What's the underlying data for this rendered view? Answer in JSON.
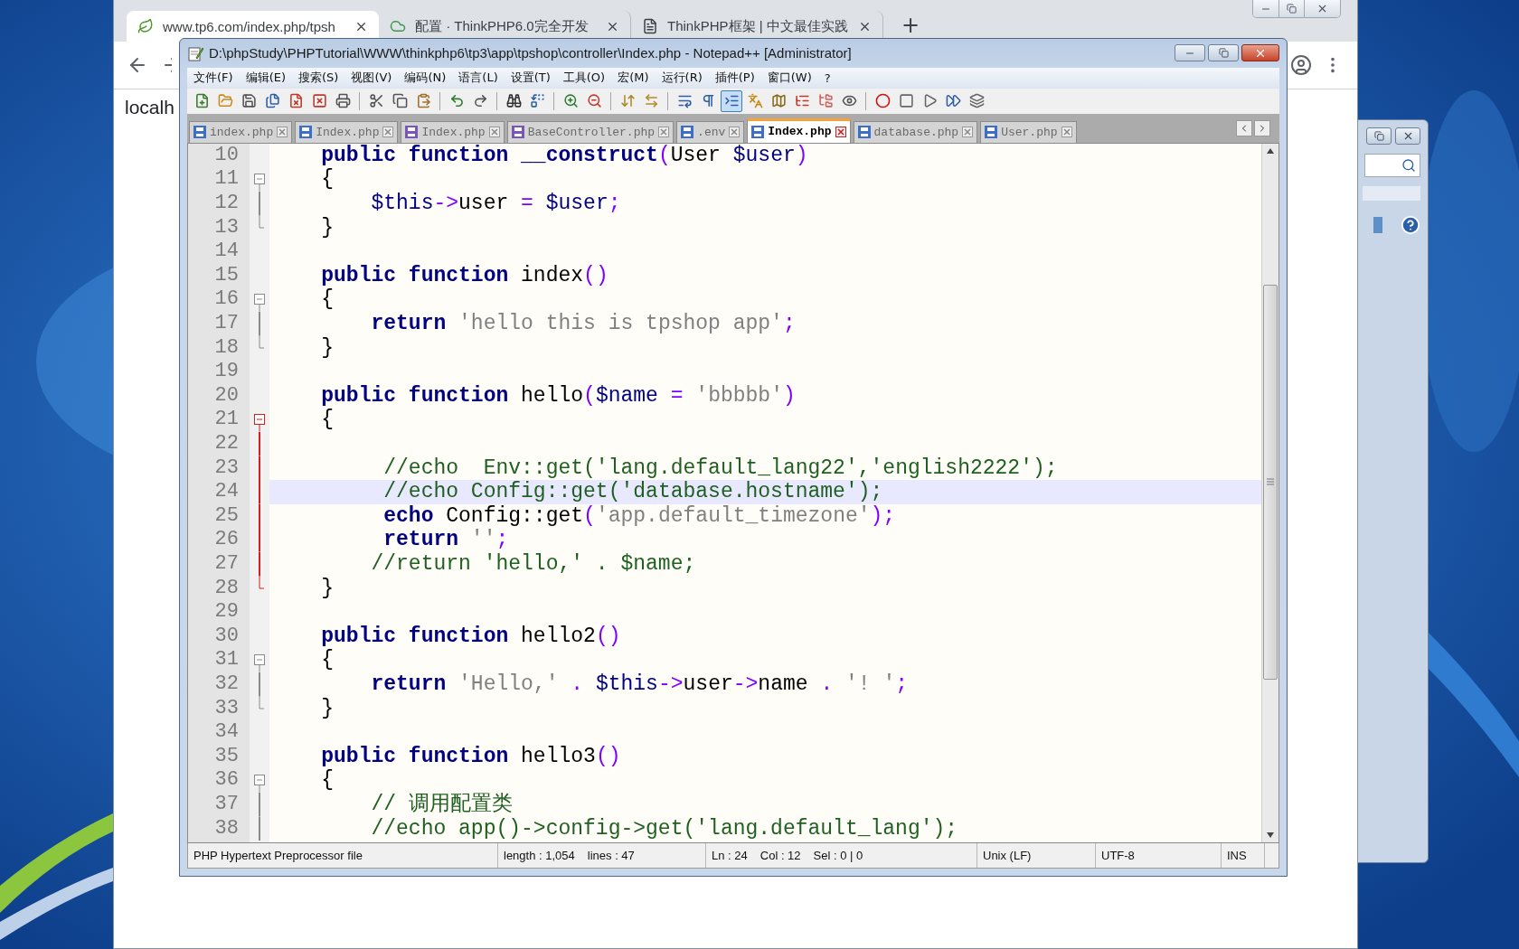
{
  "browser": {
    "tabs": [
      {
        "title": "www.tp6.com/index.php/tpsh",
        "selected": true
      },
      {
        "title": "配置 · ThinkPHP6.0完全开发",
        "selected": false
      },
      {
        "title": "ThinkPHP框架 | 中文最佳实践",
        "selected": false
      }
    ],
    "new_tab": "+",
    "page_text": "localh"
  },
  "editor_window": {
    "title": "D:\\phpStudy\\PHPTutorial\\WWW\\thinkphp6\\tp3\\app\\tpshop\\controller\\Index.php - Notepad++ [Administrator]",
    "menu": [
      "文件(F)",
      "编辑(E)",
      "搜索(S)",
      "视图(V)",
      "编码(N)",
      "语言(L)",
      "设置(T)",
      "工具(O)",
      "宏(M)",
      "运行(R)",
      "插件(P)",
      "窗口(W)",
      "?"
    ],
    "toolbar": [
      {
        "on": false
      },
      {
        "on": false
      },
      {
        "on": false
      },
      {
        "on": false
      },
      {
        "on": false
      },
      {
        "on": false
      },
      {
        "on": false
      },
      {
        "on": false
      },
      {
        "on": false
      },
      {
        "on": false
      },
      {
        "on": false
      },
      {
        "on": false
      },
      {
        "on": false
      },
      {
        "on": false
      },
      {
        "on": false
      },
      {
        "on": false
      },
      {
        "on": false
      },
      {
        "on": false
      },
      {
        "on": false
      },
      {
        "on": false
      },
      {
        "on": true
      },
      {
        "on": false
      },
      {
        "on": false
      },
      {
        "on": false
      },
      {
        "on": false
      },
      {
        "on": false
      },
      {
        "on": false
      },
      {
        "on": false
      },
      {
        "on": false
      },
      {
        "on": false
      },
      {
        "on": false
      }
    ],
    "tabs": [
      {
        "label": "index.php",
        "selected": false,
        "color": "#3b6fc9"
      },
      {
        "label": "Index.php",
        "selected": false,
        "color": "#3b6fc9"
      },
      {
        "label": "Index.php",
        "selected": false,
        "color": "#7b55b8"
      },
      {
        "label": "BaseController.php",
        "selected": false,
        "color": "#7b55b8"
      },
      {
        "label": ".env",
        "selected": false,
        "color": "#3b6fc9"
      },
      {
        "label": "Index.php",
        "selected": true,
        "color": "#3b6fc9"
      },
      {
        "label": "database.php",
        "selected": false,
        "color": "#3b6fc9"
      },
      {
        "label": "User.php",
        "selected": false,
        "color": "#3b6fc9"
      }
    ],
    "lines": [
      {
        "number": "10",
        "kind": "declaration",
        "current": false,
        "tokens": [
          {
            "kind": "keyword",
            "text": "public function __construct"
          },
          {
            "kind": "operator",
            "text": "("
          },
          {
            "kind": "plain",
            "text": "User "
          },
          {
            "kind": "variable",
            "text": "$user"
          },
          {
            "kind": "operator",
            "text": ")"
          }
        ]
      },
      {
        "number": "11",
        "kind": "declaration",
        "current": false,
        "fold": {
          "kind": "open",
          "active": false
        },
        "tokens": [
          {
            "kind": "plain",
            "text": "{"
          }
        ]
      },
      {
        "number": "12",
        "kind": "statement",
        "current": false,
        "fold": {
          "kind": "line",
          "active": false
        },
        "tokens": [
          {
            "kind": "variable",
            "text": "$this"
          },
          {
            "kind": "operator",
            "text": "->"
          },
          {
            "kind": "plain",
            "text": "user "
          },
          {
            "kind": "operator",
            "text": "="
          },
          {
            "kind": "variable",
            "text": " $user"
          },
          {
            "kind": "operator",
            "text": ";"
          }
        ]
      },
      {
        "number": "13",
        "kind": "declaration",
        "current": false,
        "fold": {
          "kind": "close",
          "active": false
        },
        "tokens": [
          {
            "kind": "plain",
            "text": "}"
          }
        ]
      },
      {
        "number": "14",
        "current": false
      },
      {
        "number": "15",
        "kind": "declaration",
        "current": false,
        "tokens": [
          {
            "kind": "keyword",
            "text": "public function"
          },
          {
            "kind": "plain",
            "text": " index"
          },
          {
            "kind": "operator",
            "text": "()"
          }
        ]
      },
      {
        "number": "16",
        "kind": "declaration",
        "current": false,
        "fold": {
          "kind": "open",
          "active": false
        },
        "tokens": [
          {
            "kind": "plain",
            "text": "{"
          }
        ]
      },
      {
        "number": "17",
        "kind": "statement",
        "current": false,
        "fold": {
          "kind": "line",
          "active": false
        },
        "tokens": [
          {
            "kind": "keyword",
            "text": "return"
          },
          {
            "kind": "string",
            "text": " 'hello this is tpshop app'"
          },
          {
            "kind": "operator",
            "text": ";"
          }
        ]
      },
      {
        "number": "18",
        "kind": "declaration",
        "current": false,
        "fold": {
          "kind": "close",
          "active": false
        },
        "tokens": [
          {
            "kind": "plain",
            "text": "}"
          }
        ]
      },
      {
        "number": "19",
        "current": false
      },
      {
        "number": "20",
        "kind": "declaration",
        "current": false,
        "tokens": [
          {
            "kind": "keyword",
            "text": "public function"
          },
          {
            "kind": "plain",
            "text": " hello"
          },
          {
            "kind": "operator",
            "text": "("
          },
          {
            "kind": "variable",
            "text": "$name"
          },
          {
            "kind": "operator",
            "text": " ="
          },
          {
            "kind": "string",
            "text": " 'bbbbb'"
          },
          {
            "kind": "operator",
            "text": ")"
          }
        ]
      },
      {
        "number": "21",
        "kind": "declaration",
        "current": false,
        "fold": {
          "kind": "open",
          "active": true
        },
        "tokens": [
          {
            "kind": "plain",
            "text": "{"
          }
        ]
      },
      {
        "number": "22",
        "current": false,
        "fold": {
          "kind": "line",
          "active": true
        }
      },
      {
        "number": "23",
        "kind": "nested",
        "current": false,
        "fold": {
          "kind": "line",
          "active": true
        },
        "tokens": [
          {
            "kind": "comment",
            "text": "//echo  Env::get('lang.default_lang22','english2222');"
          }
        ]
      },
      {
        "number": "24",
        "kind": "nested",
        "current": true,
        "fold": {
          "kind": "line",
          "active": true
        },
        "tokens": [
          {
            "kind": "comment",
            "text": "//echo Config::get('database.hostname');"
          }
        ]
      },
      {
        "number": "25",
        "kind": "nested",
        "current": false,
        "fold": {
          "kind": "line",
          "active": true
        },
        "tokens": [
          {
            "kind": "keyword",
            "text": "echo"
          },
          {
            "kind": "plain",
            "text": " Config::get"
          },
          {
            "kind": "operator",
            "text": "("
          },
          {
            "kind": "string",
            "text": "'app.default_timezone'"
          },
          {
            "kind": "operator",
            "text": ");"
          }
        ]
      },
      {
        "number": "26",
        "kind": "nested",
        "current": false,
        "fold": {
          "kind": "line",
          "active": true
        },
        "tokens": [
          {
            "kind": "keyword",
            "text": "return"
          },
          {
            "kind": "string",
            "text": " ''"
          },
          {
            "kind": "operator",
            "text": ";"
          }
        ]
      },
      {
        "number": "27",
        "kind": "statement",
        "current": false,
        "fold": {
          "kind": "line",
          "active": true
        },
        "tokens": [
          {
            "kind": "comment",
            "text": "//return 'hello,' . $name;"
          }
        ]
      },
      {
        "number": "28",
        "kind": "declaration",
        "current": false,
        "fold": {
          "kind": "close",
          "active": true
        },
        "tokens": [
          {
            "kind": "plain",
            "text": "}"
          }
        ]
      },
      {
        "number": "29",
        "current": false
      },
      {
        "number": "30",
        "kind": "declaration",
        "current": false,
        "tokens": [
          {
            "kind": "keyword",
            "text": "public function"
          },
          {
            "kind": "plain",
            "text": " hello2"
          },
          {
            "kind": "operator",
            "text": "()"
          }
        ]
      },
      {
        "number": "31",
        "kind": "declaration",
        "current": false,
        "fold": {
          "kind": "open",
          "active": false
        },
        "tokens": [
          {
            "kind": "plain",
            "text": "{"
          }
        ]
      },
      {
        "number": "32",
        "kind": "statement",
        "current": false,
        "fold": {
          "kind": "line",
          "active": false
        },
        "tokens": [
          {
            "kind": "keyword",
            "text": "return"
          },
          {
            "kind": "string",
            "text": " 'Hello,'"
          },
          {
            "kind": "operator",
            "text": " . "
          },
          {
            "kind": "variable",
            "text": "$this"
          },
          {
            "kind": "operator",
            "text": "->"
          },
          {
            "kind": "plain",
            "text": "user"
          },
          {
            "kind": "operator",
            "text": "->"
          },
          {
            "kind": "plain",
            "text": "name "
          },
          {
            "kind": "operator",
            "text": ". "
          },
          {
            "kind": "string",
            "text": "'! '"
          },
          {
            "kind": "operator",
            "text": ";"
          }
        ]
      },
      {
        "number": "33",
        "kind": "declaration",
        "current": false,
        "fold": {
          "kind": "close",
          "active": false
        },
        "tokens": [
          {
            "kind": "plain",
            "text": "}"
          }
        ]
      },
      {
        "number": "34",
        "current": false
      },
      {
        "number": "35",
        "kind": "declaration",
        "current": false,
        "tokens": [
          {
            "kind": "keyword",
            "text": "public function"
          },
          {
            "kind": "plain",
            "text": " hello3"
          },
          {
            "kind": "operator",
            "text": "()"
          }
        ]
      },
      {
        "number": "36",
        "kind": "declaration",
        "current": false,
        "fold": {
          "kind": "open",
          "active": false
        },
        "tokens": [
          {
            "kind": "plain",
            "text": "{"
          }
        ]
      },
      {
        "number": "37",
        "kind": "statement",
        "current": false,
        "fold": {
          "kind": "line",
          "active": false
        },
        "tokens": [
          {
            "kind": "comment",
            "text": "// 调用配置类"
          }
        ]
      },
      {
        "number": "38",
        "kind": "statement",
        "current": false,
        "fold": {
          "kind": "line",
          "active": false
        },
        "tokens": [
          {
            "kind": "comment",
            "text": "//echo app()->config->get('lang.default_lang');"
          }
        ]
      }
    ],
    "status_bar": [
      [
        "PHP Hypertext Preprocessor file"
      ],
      [
        "length : 1,054",
        "lines : 47"
      ],
      [
        "Ln : 24",
        "Col : 12",
        "Sel : 0 | 0"
      ],
      [
        "Unix (LF)"
      ],
      [
        "UTF-8"
      ],
      [
        "INS"
      ]
    ]
  }
}
